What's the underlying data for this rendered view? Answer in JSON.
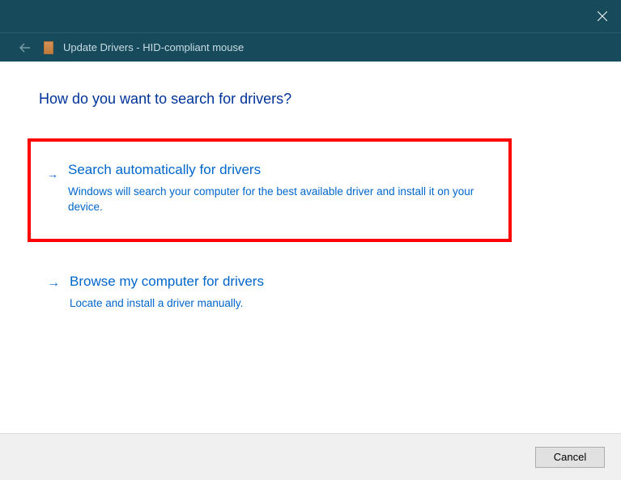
{
  "titlebar": {
    "close_label": "Close"
  },
  "header": {
    "title": "Update Drivers - HID-compliant mouse"
  },
  "main": {
    "question": "How do you want to search for drivers?",
    "options": [
      {
        "title": "Search automatically for drivers",
        "description": "Windows will search your computer for the best available driver and install it on your device.",
        "highlighted": true
      },
      {
        "title": "Browse my computer for drivers",
        "description": "Locate and install a driver manually.",
        "highlighted": false
      }
    ]
  },
  "footer": {
    "cancel_label": "Cancel"
  }
}
